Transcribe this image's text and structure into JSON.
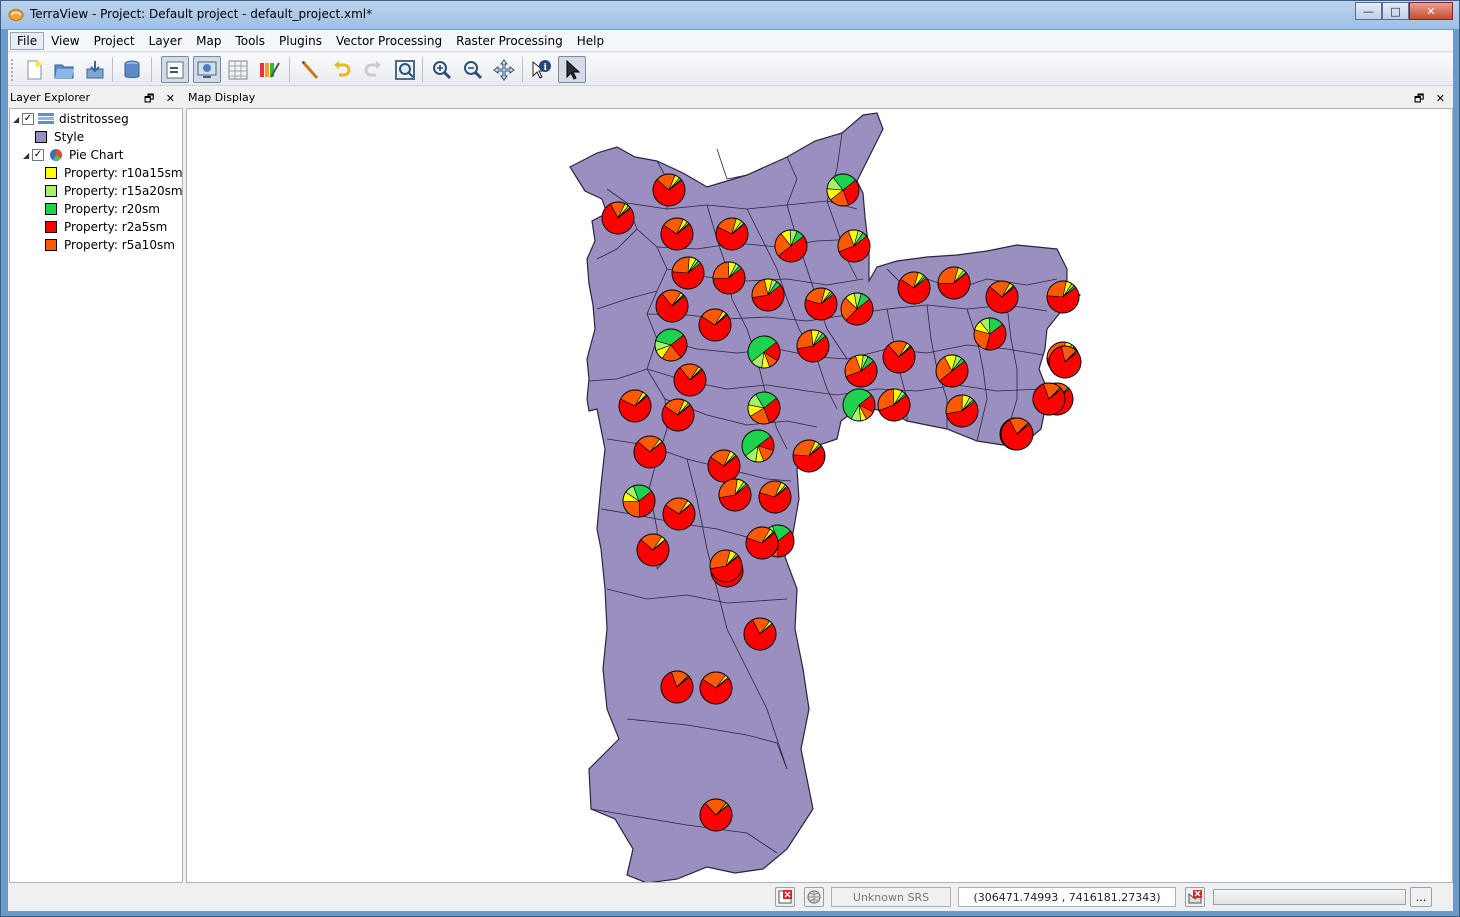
{
  "window": {
    "title": "TerraView - Project: Default project - default_project.xml*",
    "minimize_label": "—",
    "maximize_label": "□",
    "close_label": "✕"
  },
  "menubar": {
    "items": [
      "File",
      "View",
      "Project",
      "Layer",
      "Map",
      "Tools",
      "Plugins",
      "Vector Processing",
      "Raster Processing",
      "Help"
    ]
  },
  "toolbar": {
    "icons": [
      "new-project-icon",
      "open-project-icon",
      "save-project-icon",
      "database-icon",
      "layer-explorer-icon",
      "map-display-icon",
      "data-table-icon",
      "style-explorer-icon",
      "measure-distance-icon",
      "undo-icon",
      "redo-icon",
      "zoom-extent-icon",
      "zoom-in-icon",
      "zoom-out-icon",
      "pan-icon",
      "info-icon",
      "selection-icon"
    ]
  },
  "layer_explorer": {
    "title": "Layer Explorer",
    "dock_controls": "🗗 ✕",
    "root_layer": {
      "name": "distritosseg",
      "checked": true,
      "expanded": true
    },
    "style": {
      "label": "Style",
      "color": "#9b8fc0"
    },
    "chart": {
      "label": "Pie Chart",
      "checked": true,
      "expanded": true
    },
    "legend": [
      {
        "label": "Property: r10a15sm",
        "color": "#ffff00"
      },
      {
        "label": "Property: r15a20sm",
        "color": "#a6f06a"
      },
      {
        "label": "Property: r20sm",
        "color": "#1fd24d"
      },
      {
        "label": "Property: r2a5sm",
        "color": "#ff0000"
      },
      {
        "label": "Property: r5a10sm",
        "color": "#ff5a00"
      }
    ]
  },
  "map_display": {
    "title": "Map Display",
    "dock_controls": "🗗 ✕",
    "fill_color": "#9b8fc0",
    "pie_colors": [
      "#ff0000",
      "#ff5a00",
      "#ffff00",
      "#a6f06a",
      "#1fd24d"
    ],
    "pies": [
      [
        0.72,
        0.2,
        0.05,
        0.02,
        0.01
      ],
      [
        0.78,
        0.15,
        0.04,
        0.02,
        0.01
      ],
      [
        0.7,
        0.22,
        0.05,
        0.02,
        0.01
      ],
      [
        0.68,
        0.22,
        0.06,
        0.03,
        0.01
      ],
      [
        0.5,
        0.25,
        0.1,
        0.07,
        0.08
      ],
      [
        0.55,
        0.25,
        0.1,
        0.05,
        0.05
      ],
      [
        0.3,
        0.2,
        0.12,
        0.13,
        0.25
      ],
      [
        0.62,
        0.25,
        0.07,
        0.03,
        0.03
      ],
      [
        0.6,
        0.25,
        0.08,
        0.04,
        0.03
      ],
      [
        0.58,
        0.24,
        0.08,
        0.05,
        0.05
      ],
      [
        0.65,
        0.25,
        0.06,
        0.02,
        0.02
      ],
      [
        0.48,
        0.25,
        0.1,
        0.07,
        0.1
      ],
      [
        0.7,
        0.2,
        0.06,
        0.02,
        0.02
      ],
      [
        0.6,
        0.3,
        0.06,
        0.03,
        0.01
      ],
      [
        0.72,
        0.22,
        0.04,
        0.01,
        0.01
      ],
      [
        0.62,
        0.27,
        0.06,
        0.03,
        0.02
      ],
      [
        0.75,
        0.2,
        0.03,
        0.01,
        0.01
      ],
      [
        0.7,
        0.24,
        0.04,
        0.01,
        0.01
      ],
      [
        0.4,
        0.25,
        0.1,
        0.1,
        0.15
      ],
      [
        0.6,
        0.28,
        0.07,
        0.03,
        0.02
      ],
      [
        0.25,
        0.2,
        0.1,
        0.1,
        0.35
      ],
      [
        0.2,
        0.1,
        0.08,
        0.12,
        0.5
      ],
      [
        0.58,
        0.26,
        0.08,
        0.04,
        0.04
      ],
      [
        0.55,
        0.25,
        0.08,
        0.05,
        0.07
      ],
      [
        0.74,
        0.2,
        0.04,
        0.01,
        0.01
      ],
      [
        0.5,
        0.28,
        0.12,
        0.06,
        0.04
      ],
      [
        0.68,
        0.26,
        0.04,
        0.01,
        0.01
      ],
      [
        0.7,
        0.22,
        0.05,
        0.02,
        0.01
      ],
      [
        0.75,
        0.2,
        0.03,
        0.01,
        0.01
      ],
      [
        0.3,
        0.22,
        0.12,
        0.13,
        0.23
      ],
      [
        0.18,
        0.1,
        0.06,
        0.1,
        0.56
      ],
      [
        0.55,
        0.3,
        0.09,
        0.04,
        0.02
      ],
      [
        0.58,
        0.28,
        0.08,
        0.04,
        0.02
      ],
      [
        0.6,
        0.3,
        0.07,
        0.02,
        0.01
      ],
      [
        0.4,
        0.25,
        0.1,
        0.08,
        0.17
      ],
      [
        0.15,
        0.15,
        0.08,
        0.12,
        0.5
      ],
      [
        0.62,
        0.3,
        0.05,
        0.02,
        0.01
      ],
      [
        0.72,
        0.24,
        0.03,
        0.01,
        0.0
      ],
      [
        0.7,
        0.22,
        0.05,
        0.02,
        0.01
      ],
      [
        0.35,
        0.25,
        0.1,
        0.1,
        0.2
      ],
      [
        0.58,
        0.3,
        0.07,
        0.03,
        0.02
      ],
      [
        0.7,
        0.25,
        0.04,
        0.01,
        0.0
      ],
      [
        0.65,
        0.27,
        0.05,
        0.02,
        0.01
      ],
      [
        0.72,
        0.23,
        0.04,
        0.01,
        0.0
      ],
      [
        0.36,
        0.24,
        0.1,
        0.1,
        0.2
      ],
      [
        0.62,
        0.3,
        0.05,
        0.02,
        0.01
      ],
      [
        0.66,
        0.28,
        0.04,
        0.01,
        0.01
      ],
      [
        0.78,
        0.18,
        0.03,
        0.01,
        0.0
      ],
      [
        0.58,
        0.32,
        0.07,
        0.02,
        0.01
      ],
      [
        0.7,
        0.26,
        0.03,
        0.01,
        0.0
      ],
      [
        0.74,
        0.23,
        0.02,
        0.01,
        0.0
      ],
      [
        0.8,
        0.18,
        0.01,
        0.01,
        0.0
      ],
      [
        0.76,
        0.22,
        0.01,
        0.01,
        0.0
      ],
      [
        0.82,
        0.16,
        0.01,
        0.01,
        0.0
      ],
      [
        0.8,
        0.18,
        0.01,
        0.01,
        0.0
      ],
      [
        0.78,
        0.2,
        0.01,
        0.01,
        0.0
      ]
    ]
  },
  "statusbar": {
    "srs": "Unknown SRS",
    "coordinates": "(306471.74993 , 7416181.27343)",
    "more_label": "..."
  }
}
